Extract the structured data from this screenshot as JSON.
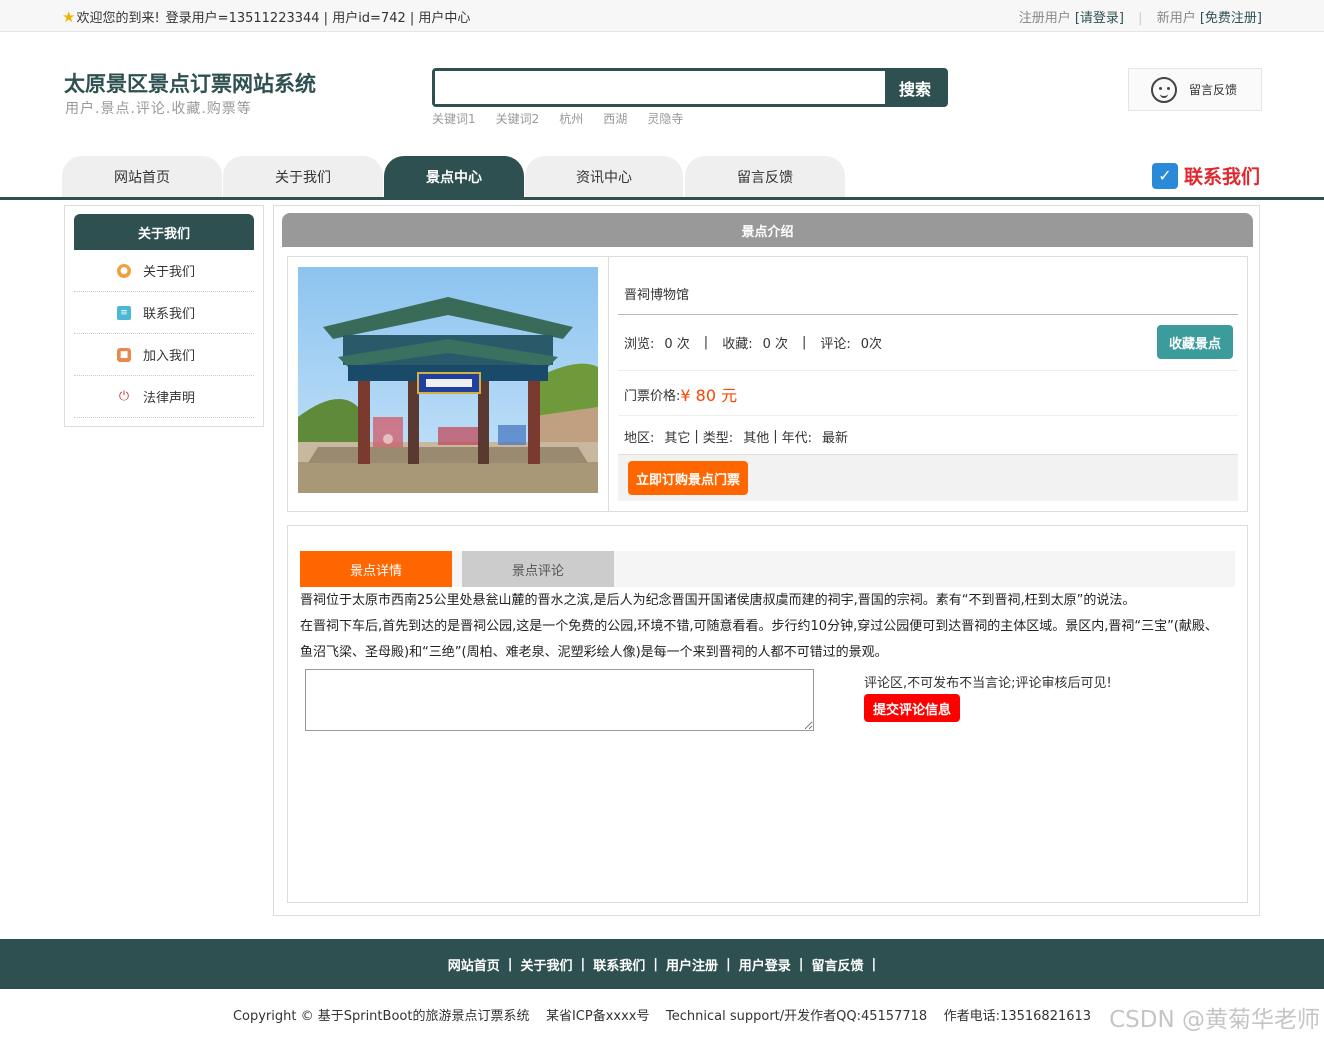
{
  "topbar": {
    "welcome": "欢迎您的到来!",
    "login_info": "登录用户=13511223344 | 用户id=742 | 用户中心",
    "reg_label": "注册用户",
    "login_link": "[请登录]",
    "new_user": "新用户",
    "free_reg": "[免费注册]"
  },
  "header": {
    "title": "太原景区景点订票网站系统",
    "subtitle": "用户.景点.评论.收藏.购票等",
    "search_button": "搜索",
    "search_value": "",
    "keywords": [
      "关键词1",
      "关键词2",
      "杭州",
      "西湖",
      "灵隐寺"
    ],
    "feedback": "留言反馈"
  },
  "nav": {
    "tabs": [
      "网站首页",
      "关于我们",
      "景点中心",
      "资讯中心",
      "留言反馈"
    ],
    "active": "景点中心",
    "contact": "联系我们"
  },
  "sidebar": {
    "title": "关于我们",
    "items": [
      "关于我们",
      "联系我们",
      "加入我们",
      "法律声明"
    ]
  },
  "main": {
    "section_title": "景点介绍",
    "name": "晋祠博物馆",
    "stats": {
      "views_label": "浏览:",
      "views": "0 次",
      "fav_label": "收藏:",
      "fav": "0 次",
      "comments_label": "评论:",
      "comments": "0次"
    },
    "collect_button": "收藏景点",
    "price_label": "门票价格:",
    "price": "¥ 80 元",
    "region_label": "地区:",
    "region": "其它",
    "type_label": "类型:",
    "type": "其他",
    "era_label": "年代:",
    "era": "最新",
    "buy_button": "立即订购景点门票"
  },
  "detail": {
    "tab_detail": "景点详情",
    "tab_comment": "景点评论",
    "text1": "晋祠位于太原市西南25公里处悬瓮山麓的晋水之滨,是后人为纪念晋国开国诸侯唐叔虞而建的祠宇,晋国的宗祠。素有“不到晋祠,枉到太原”的说法。",
    "text2": "在晋祠下车后,首先到达的是晋祠公园,这是一个免费的公园,环境不错,可随意看看。步行约10分钟,穿过公园便可到达晋祠的主体区域。景区内,晋祠“三宝”(献殿、鱼沼飞梁、圣母殿)和“三绝”(周柏、难老泉、泥塑彩绘人像)是每一个来到晋祠的人都不可错过的景观。",
    "comment_note": "评论区,不可发布不当言论;评论审核后可见!",
    "submit_button": "提交评论信息"
  },
  "footer": {
    "links": [
      "网站首页",
      "关于我们",
      "联系我们",
      "用户注册",
      "用户登录",
      "留言反馈"
    ],
    "copyright": "Copyright © 基于SprintBoot的旅游景点订票系统    某省ICP备xxxx号    Technical support/开发作者QQ:45157718    作者电话:13516821613",
    "watermark": "CSDN @黄菊华老师"
  },
  "colors": {
    "primary": "#2f5050",
    "orange": "#ff6600",
    "red": "#ff0000",
    "teal": "#3c9c9c"
  }
}
